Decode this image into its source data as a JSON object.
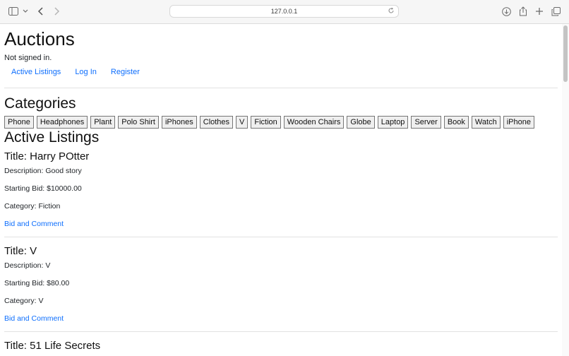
{
  "browser": {
    "url": "127.0.0.1",
    "icons": [
      "sidebar-icon",
      "chevron-down-icon",
      "back-icon",
      "forward-icon",
      "reload-icon",
      "download-icon",
      "share-icon",
      "new-tab-icon",
      "tabs-overview-icon"
    ]
  },
  "header": {
    "title": "Auctions",
    "signin_status": "Not signed in.",
    "nav": [
      "Active Listings",
      "Log In",
      "Register"
    ]
  },
  "categories": {
    "heading": "Categories",
    "items": [
      "Phone",
      "Headphones",
      "Plant",
      "Polo Shirt",
      "iPhones",
      "Clothes",
      "V",
      "Fiction",
      "Wooden Chairs",
      "Globe",
      "Laptop",
      "Server",
      "Book",
      "Watch",
      "iPhone"
    ]
  },
  "listings": {
    "heading": "Active Listings",
    "items": [
      {
        "title": "Title: Harry POtter",
        "description": "Description: Good story",
        "starting_bid": "Starting Bid: $10000.00",
        "category": "Category: Fiction",
        "link": "Bid and Comment"
      },
      {
        "title": "Title: V",
        "description": "Description: V",
        "starting_bid": "Starting Bid: $80.00",
        "category": "Category: V",
        "link": "Bid and Comment"
      },
      {
        "title": "Title: 51 Life Secrets"
      }
    ]
  },
  "colors": {
    "link": "#0d6efd",
    "text": "#212529"
  }
}
